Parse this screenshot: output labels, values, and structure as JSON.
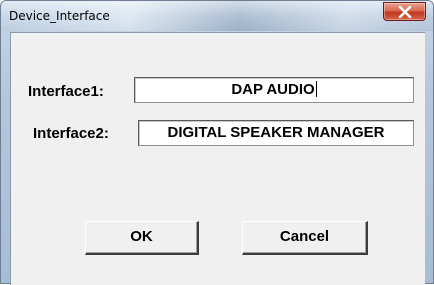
{
  "window": {
    "title": "Device_Interface",
    "close_icon": "close-x-icon"
  },
  "form": {
    "interface1": {
      "label": "Interface1:",
      "value": "DAP AUDIO"
    },
    "interface2": {
      "label": "Interface2:",
      "value": "DIGITAL SPEAKER MANAGER"
    }
  },
  "buttons": {
    "ok_label": "OK",
    "cancel_label": "Cancel"
  },
  "colors": {
    "close_button": "#c9432b",
    "client_background": "#f0f0f0",
    "titlebar": "#b3c6dc"
  }
}
